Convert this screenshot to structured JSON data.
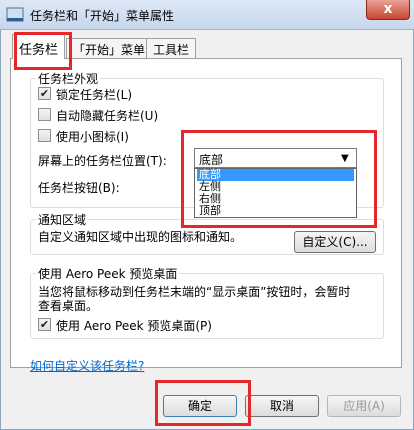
{
  "window": {
    "title": "任务栏和「开始」菜单属性",
    "close": "x"
  },
  "tabs": [
    {
      "label": "任务栏",
      "active": true
    },
    {
      "label": "「开始」菜单",
      "active": false
    },
    {
      "label": "工具栏",
      "active": false
    }
  ],
  "appearance": {
    "legend": "任务栏外观",
    "lock": {
      "label": "锁定任务栏(L)",
      "checked": "✔"
    },
    "autohide": {
      "label": "自动隐藏任务栏(U)"
    },
    "small_icons": {
      "label": "使用小图标(I)"
    },
    "location_label": "屏幕上的任务栏位置(T):",
    "location_value": "底部",
    "location_options": [
      "底部",
      "左侧",
      "右侧",
      "顶部"
    ],
    "buttons_label": "任务栏按钮(B):"
  },
  "notify": {
    "legend": "通知区域",
    "desc": "自定义通知区域中出现的图标和通知。",
    "customize": "自定义(C)..."
  },
  "peek": {
    "legend": "使用 Aero Peek 预览桌面",
    "desc_line1": "当您将鼠标移动到任务栏末端的“显示桌面”按钮时，会暂时",
    "desc_line2": "查看桌面。",
    "checkbox": {
      "label": "使用 Aero Peek 预览桌面(P)",
      "checked": "✔"
    }
  },
  "help_link": "如何自定义该任务栏?",
  "footer": {
    "ok": "确定",
    "cancel": "取消",
    "apply": "应用(A)"
  },
  "colors": {
    "accent": "#3399ff",
    "highlight": "#e5262a"
  }
}
